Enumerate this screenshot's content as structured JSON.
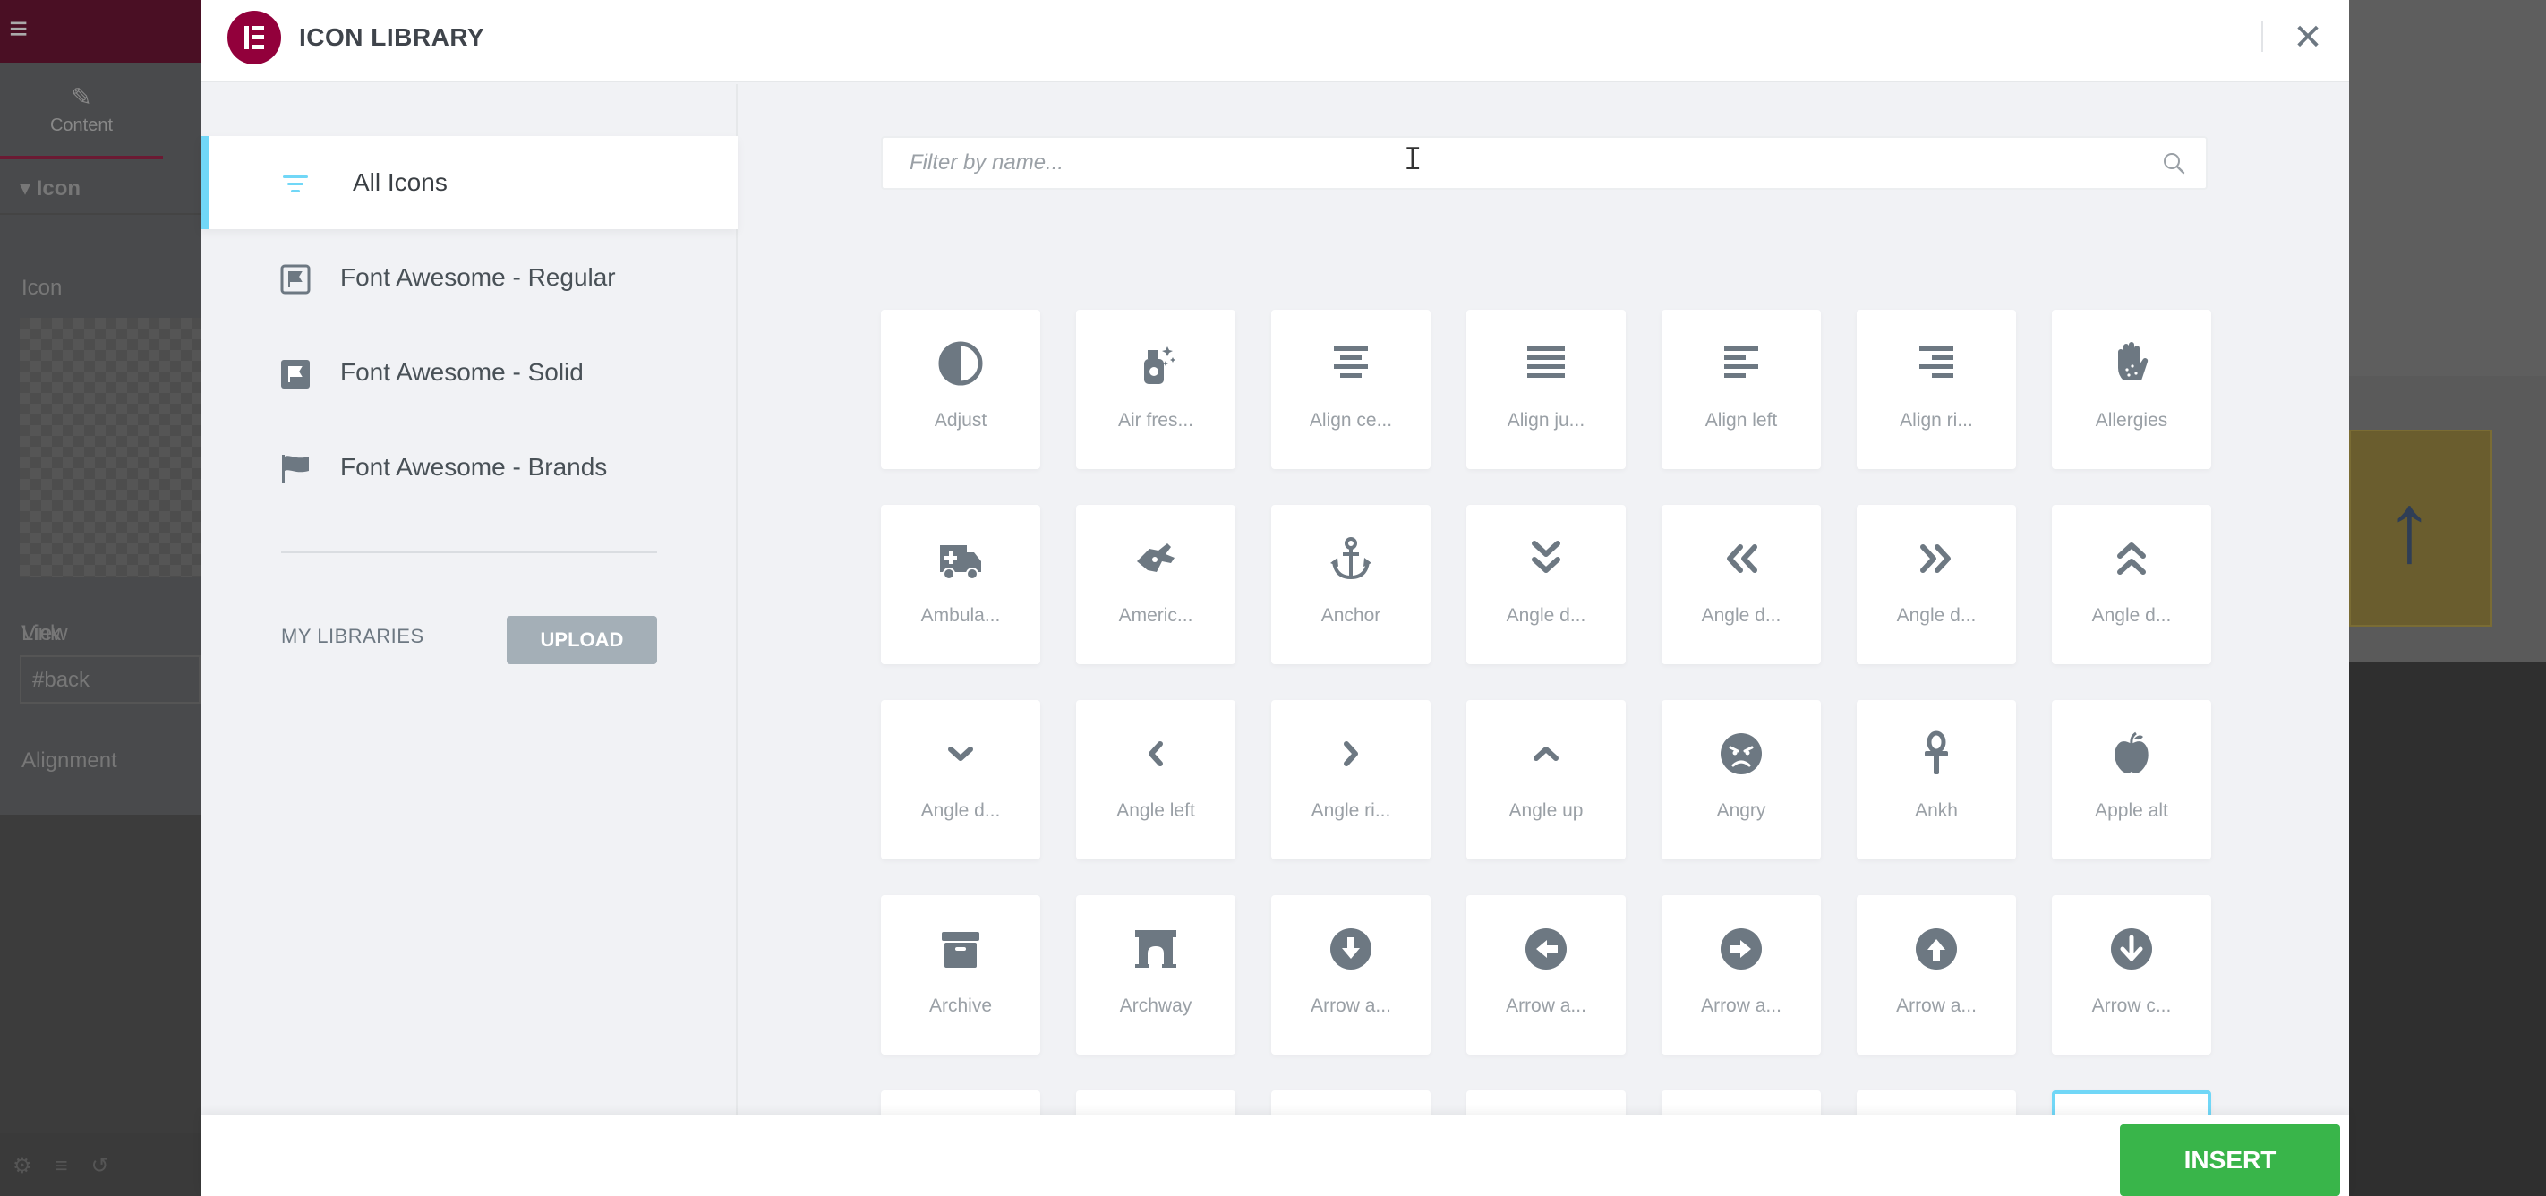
{
  "background_editor": {
    "tab_label": "Content",
    "section_title": "Icon",
    "field_icon": "Icon",
    "field_view": "View",
    "field_link": "Link",
    "link_value": "#back",
    "field_alignment": "Alignment"
  },
  "modal": {
    "title": "ICON LIBRARY",
    "close_icon": "close-icon",
    "sidebar": {
      "tabs": [
        {
          "label": "All Icons",
          "icon": "filter-lines-icon",
          "active": true
        },
        {
          "label": "Font Awesome - Regular",
          "icon": "flag-outline-icon",
          "active": false
        },
        {
          "label": "Font Awesome - Solid",
          "icon": "flag-solid-icon",
          "active": false
        },
        {
          "label": "Font Awesome - Brands",
          "icon": "flag-icon",
          "active": false
        }
      ],
      "my_libraries": "MY LIBRARIES",
      "upload_label": "UPLOAD"
    },
    "search": {
      "placeholder": "Filter by name...",
      "value": ""
    },
    "icons": [
      {
        "name": "Adjust",
        "glyph": "adjust"
      },
      {
        "name": "Air fres...",
        "glyph": "air-freshener"
      },
      {
        "name": "Align ce...",
        "glyph": "align-center"
      },
      {
        "name": "Align ju...",
        "glyph": "align-justify"
      },
      {
        "name": "Align left",
        "glyph": "align-left"
      },
      {
        "name": "Align ri...",
        "glyph": "align-right"
      },
      {
        "name": "Allergies",
        "glyph": "allergies"
      },
      {
        "name": "Ambula...",
        "glyph": "ambulance"
      },
      {
        "name": "Americ...",
        "glyph": "american-sign-language"
      },
      {
        "name": "Anchor",
        "glyph": "anchor"
      },
      {
        "name": "Angle d...",
        "glyph": "angle-double-down"
      },
      {
        "name": "Angle d...",
        "glyph": "angle-double-left"
      },
      {
        "name": "Angle d...",
        "glyph": "angle-double-right"
      },
      {
        "name": "Angle d...",
        "glyph": "angle-double-up"
      },
      {
        "name": "Angle d...",
        "glyph": "angle-down"
      },
      {
        "name": "Angle left",
        "glyph": "angle-left"
      },
      {
        "name": "Angle ri...",
        "glyph": "angle-right"
      },
      {
        "name": "Angle up",
        "glyph": "angle-up"
      },
      {
        "name": "Angry",
        "glyph": "angry"
      },
      {
        "name": "Ankh",
        "glyph": "ankh"
      },
      {
        "name": "Apple alt",
        "glyph": "apple-alt"
      },
      {
        "name": "Archive",
        "glyph": "archive"
      },
      {
        "name": "Archway",
        "glyph": "archway"
      },
      {
        "name": "Arrow a...",
        "glyph": "arrow-alt-circle-down"
      },
      {
        "name": "Arrow a...",
        "glyph": "arrow-alt-circle-left"
      },
      {
        "name": "Arrow a...",
        "glyph": "arrow-alt-circle-right"
      },
      {
        "name": "Arrow a...",
        "glyph": "arrow-alt-circle-up"
      },
      {
        "name": "Arrow c...",
        "glyph": "arrow-circle-down"
      },
      {
        "name": "",
        "glyph": ""
      },
      {
        "name": "",
        "glyph": ""
      },
      {
        "name": "",
        "glyph": ""
      },
      {
        "name": "",
        "glyph": ""
      },
      {
        "name": "",
        "glyph": ""
      },
      {
        "name": "",
        "glyph": ""
      },
      {
        "name": "",
        "glyph": "",
        "selected": true
      }
    ],
    "insert_label": "INSERT"
  },
  "colors": {
    "brand": "#92003b",
    "active_tab_accent": "#71d7f7",
    "insert_green": "#39b54a",
    "upload_grey": "#a4afb7",
    "icon_grey": "#6d7882"
  }
}
